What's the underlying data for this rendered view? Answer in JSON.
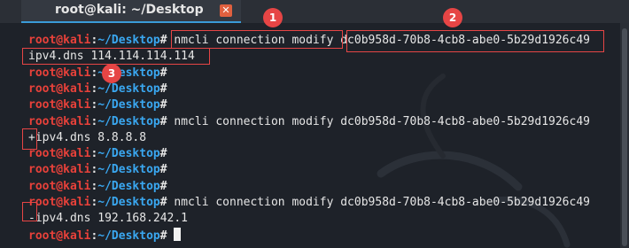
{
  "window": {
    "tab_title": "root@kali: ~/Desktop",
    "close_glyph": "✕"
  },
  "prompt": {
    "user": "root@kali",
    "sep": ":",
    "path": "~/Desktop",
    "symbol": "#"
  },
  "lines": [
    {
      "prompt": true,
      "cmd": " nmcli connection modify dc0b958d-70b8-4cb8-abe0-5b29d1926c49"
    },
    {
      "prompt": false,
      "cmd": "ipv4.dns 114.114.114.114"
    },
    {
      "prompt": true,
      "cmd": ""
    },
    {
      "prompt": true,
      "cmd": ""
    },
    {
      "prompt": true,
      "cmd": ""
    },
    {
      "prompt": true,
      "cmd": " nmcli connection modify dc0b958d-70b8-4cb8-abe0-5b29d1926c49"
    },
    {
      "prompt": false,
      "cmd": "+ipv4.dns 8.8.8.8"
    },
    {
      "prompt": true,
      "cmd": ""
    },
    {
      "prompt": true,
      "cmd": ""
    },
    {
      "prompt": true,
      "cmd": ""
    },
    {
      "prompt": true,
      "cmd": " nmcli connection modify dc0b958d-70b8-4cb8-abe0-5b29d1926c49"
    },
    {
      "prompt": false,
      "cmd": "-ipv4.dns 192.168.242.1"
    },
    {
      "prompt": true,
      "cmd": " "
    }
  ],
  "annotations": [
    "1",
    "2",
    "3"
  ],
  "colors": {
    "background": "#1e2229",
    "user": "#e8413a",
    "path": "#3aa7f0",
    "annotation": "#e64545"
  }
}
